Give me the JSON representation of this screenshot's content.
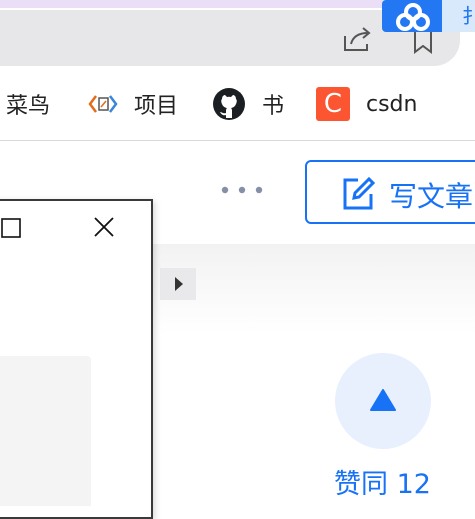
{
  "extension": {
    "tab_label": "扌",
    "icon": "cloud-link-icon"
  },
  "address_bar": {
    "share_icon": "share-icon",
    "favorite_icon": "star-icon"
  },
  "bookmarks": [
    {
      "label": "菜鸟",
      "icon": ""
    },
    {
      "label": "项目",
      "icon": "code-bracket-icon"
    },
    {
      "label": "书",
      "icon": "github-icon"
    },
    {
      "label": "csdn",
      "icon": "csdn-icon",
      "icon_text": "C"
    }
  ],
  "toolbar": {
    "more_icon": "ellipsis-icon",
    "write_button_label": "写文章",
    "write_icon": "edit-icon"
  },
  "upvote": {
    "label": "赞同 12",
    "icon": "triangle-up-icon"
  },
  "popup": {
    "maximize_icon": "maximize-icon",
    "close_icon": "close-icon"
  },
  "colors": {
    "accent": "#1772f6",
    "extension_blue": "#2477f2",
    "csdn_orange": "#fc5531",
    "upvote_bg": "#e8f0fd",
    "address_bar": "#e7e7e9"
  }
}
